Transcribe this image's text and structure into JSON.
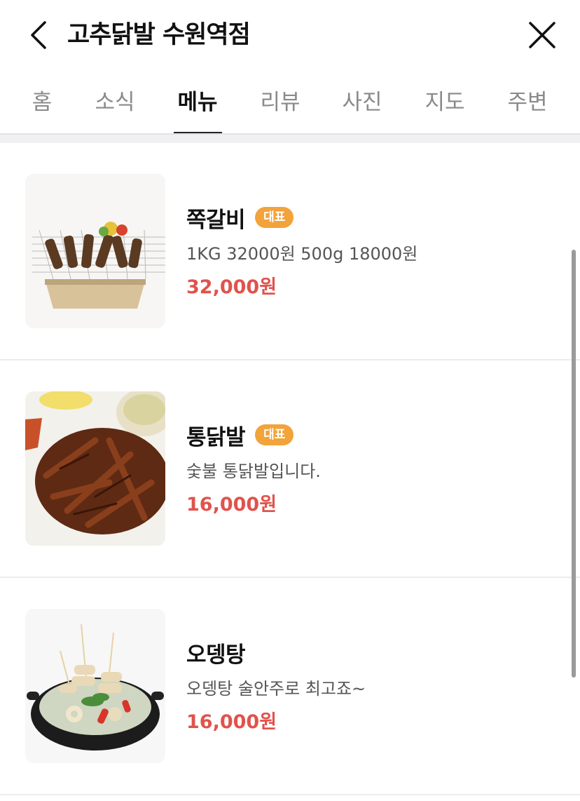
{
  "header": {
    "title": "고추닭발 수원역점"
  },
  "tabs": [
    {
      "label": "홈",
      "active": false
    },
    {
      "label": "소식",
      "active": false
    },
    {
      "label": "메뉴",
      "active": true
    },
    {
      "label": "리뷰",
      "active": false
    },
    {
      "label": "사진",
      "active": false
    },
    {
      "label": "지도",
      "active": false
    },
    {
      "label": "주변",
      "active": false
    }
  ],
  "menu": {
    "items": [
      {
        "name": "쪽갈비",
        "badge": "대표",
        "desc": "1KG 32000원 500g 18000원",
        "price": "32,000원",
        "image": "grilled-ribs-photo"
      },
      {
        "name": "통닭발",
        "badge": "대표",
        "desc": "숯불 통닭발입니다.",
        "price": "16,000원",
        "image": "chicken-feet-photo"
      },
      {
        "name": "오뎅탕",
        "badge": "",
        "desc": "오뎅탕 술안주로 최고죠~",
        "price": "16,000원",
        "image": "fishcake-soup-photo"
      }
    ]
  },
  "colors": {
    "accent_price": "#e0534d",
    "badge": "#f2a33a",
    "tab_active": "#111111",
    "tab_inactive": "#8a8a8a"
  }
}
